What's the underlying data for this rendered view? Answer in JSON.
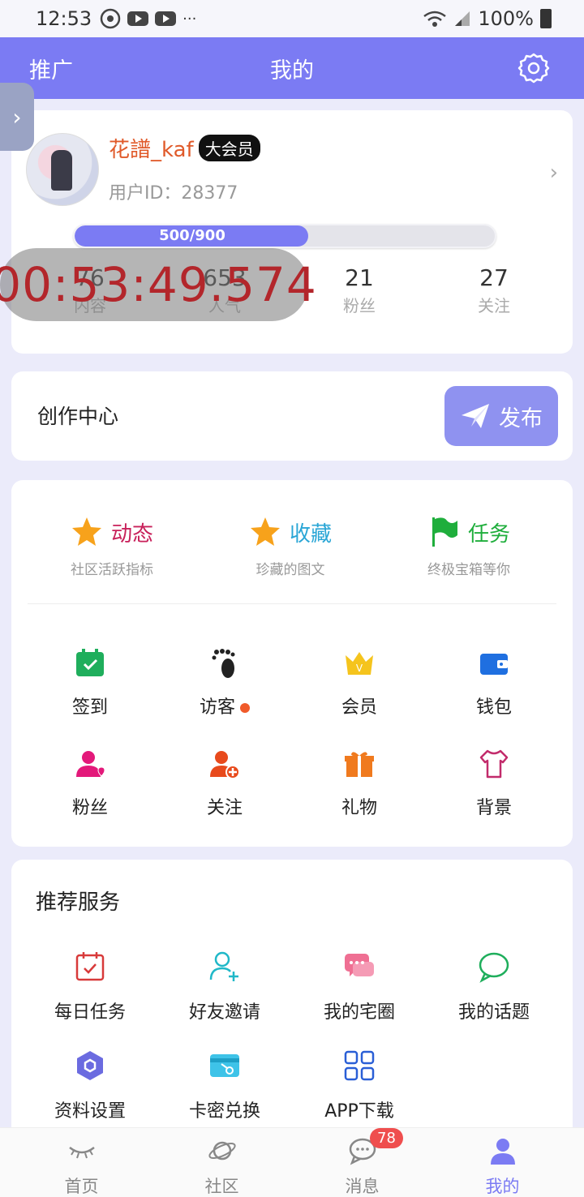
{
  "status_bar": {
    "time": "12:53",
    "battery": "100%"
  },
  "app_bar": {
    "left": "推广",
    "title": "我的"
  },
  "profile": {
    "username": "花譜_kaf",
    "vip_badge": "大会员",
    "user_id": "用户ID：28377",
    "progress_text": "500/900",
    "progress_fraction": 0.556,
    "stats": [
      {
        "value": "76",
        "label": "内容"
      },
      {
        "value": "653",
        "label": "人气"
      },
      {
        "value": "21",
        "label": "粉丝"
      },
      {
        "value": "27",
        "label": "关注"
      }
    ]
  },
  "timer_overlay": "00:53:49.574",
  "create_center": {
    "title": "创作中心",
    "publish_label": "发布"
  },
  "features": {
    "top": [
      {
        "label": "动态",
        "sub": "社区活跃指标",
        "color": "#c8205a",
        "icon": "star-icon"
      },
      {
        "label": "收藏",
        "sub": "珍藏的图文",
        "color": "#2aa6d6",
        "icon": "star-icon"
      },
      {
        "label": "任务",
        "sub": "终极宝箱等你",
        "color": "#1fae3c",
        "icon": "flag-icon"
      }
    ],
    "row1": [
      {
        "label": "签到",
        "icon": "checkin-icon"
      },
      {
        "label": "访客",
        "icon": "footprint-icon"
      },
      {
        "label": "会员",
        "icon": "crown-icon"
      },
      {
        "label": "钱包",
        "icon": "wallet-icon"
      }
    ],
    "row2": [
      {
        "label": "粉丝",
        "icon": "fans-icon"
      },
      {
        "label": "关注",
        "icon": "follow-icon"
      },
      {
        "label": "礼物",
        "icon": "gift-icon"
      },
      {
        "label": "背景",
        "icon": "shirt-icon"
      }
    ]
  },
  "services": {
    "title": "推荐服务",
    "row1": [
      {
        "label": "每日任务",
        "icon": "calendar-icon"
      },
      {
        "label": "好友邀请",
        "icon": "invite-icon"
      },
      {
        "label": "我的宅圈",
        "icon": "chat-bubbles-icon"
      },
      {
        "label": "我的话题",
        "icon": "speech-bubble-icon"
      }
    ],
    "row2": [
      {
        "label": "资料设置",
        "icon": "hexagon-settings-icon"
      },
      {
        "label": "卡密兑换",
        "icon": "card-key-icon"
      },
      {
        "label": "APP下载",
        "icon": "apps-grid-icon"
      }
    ]
  },
  "bottom_nav": [
    {
      "label": "首页",
      "icon": "eye-icon"
    },
    {
      "label": "社区",
      "icon": "planet-icon"
    },
    {
      "label": "消息",
      "icon": "message-icon",
      "badge": "78"
    },
    {
      "label": "我的",
      "icon": "person-icon",
      "active": true
    }
  ],
  "colors": {
    "accent": "#7b7bf3",
    "background": "#ebebfa",
    "username": "#e05a2a"
  }
}
